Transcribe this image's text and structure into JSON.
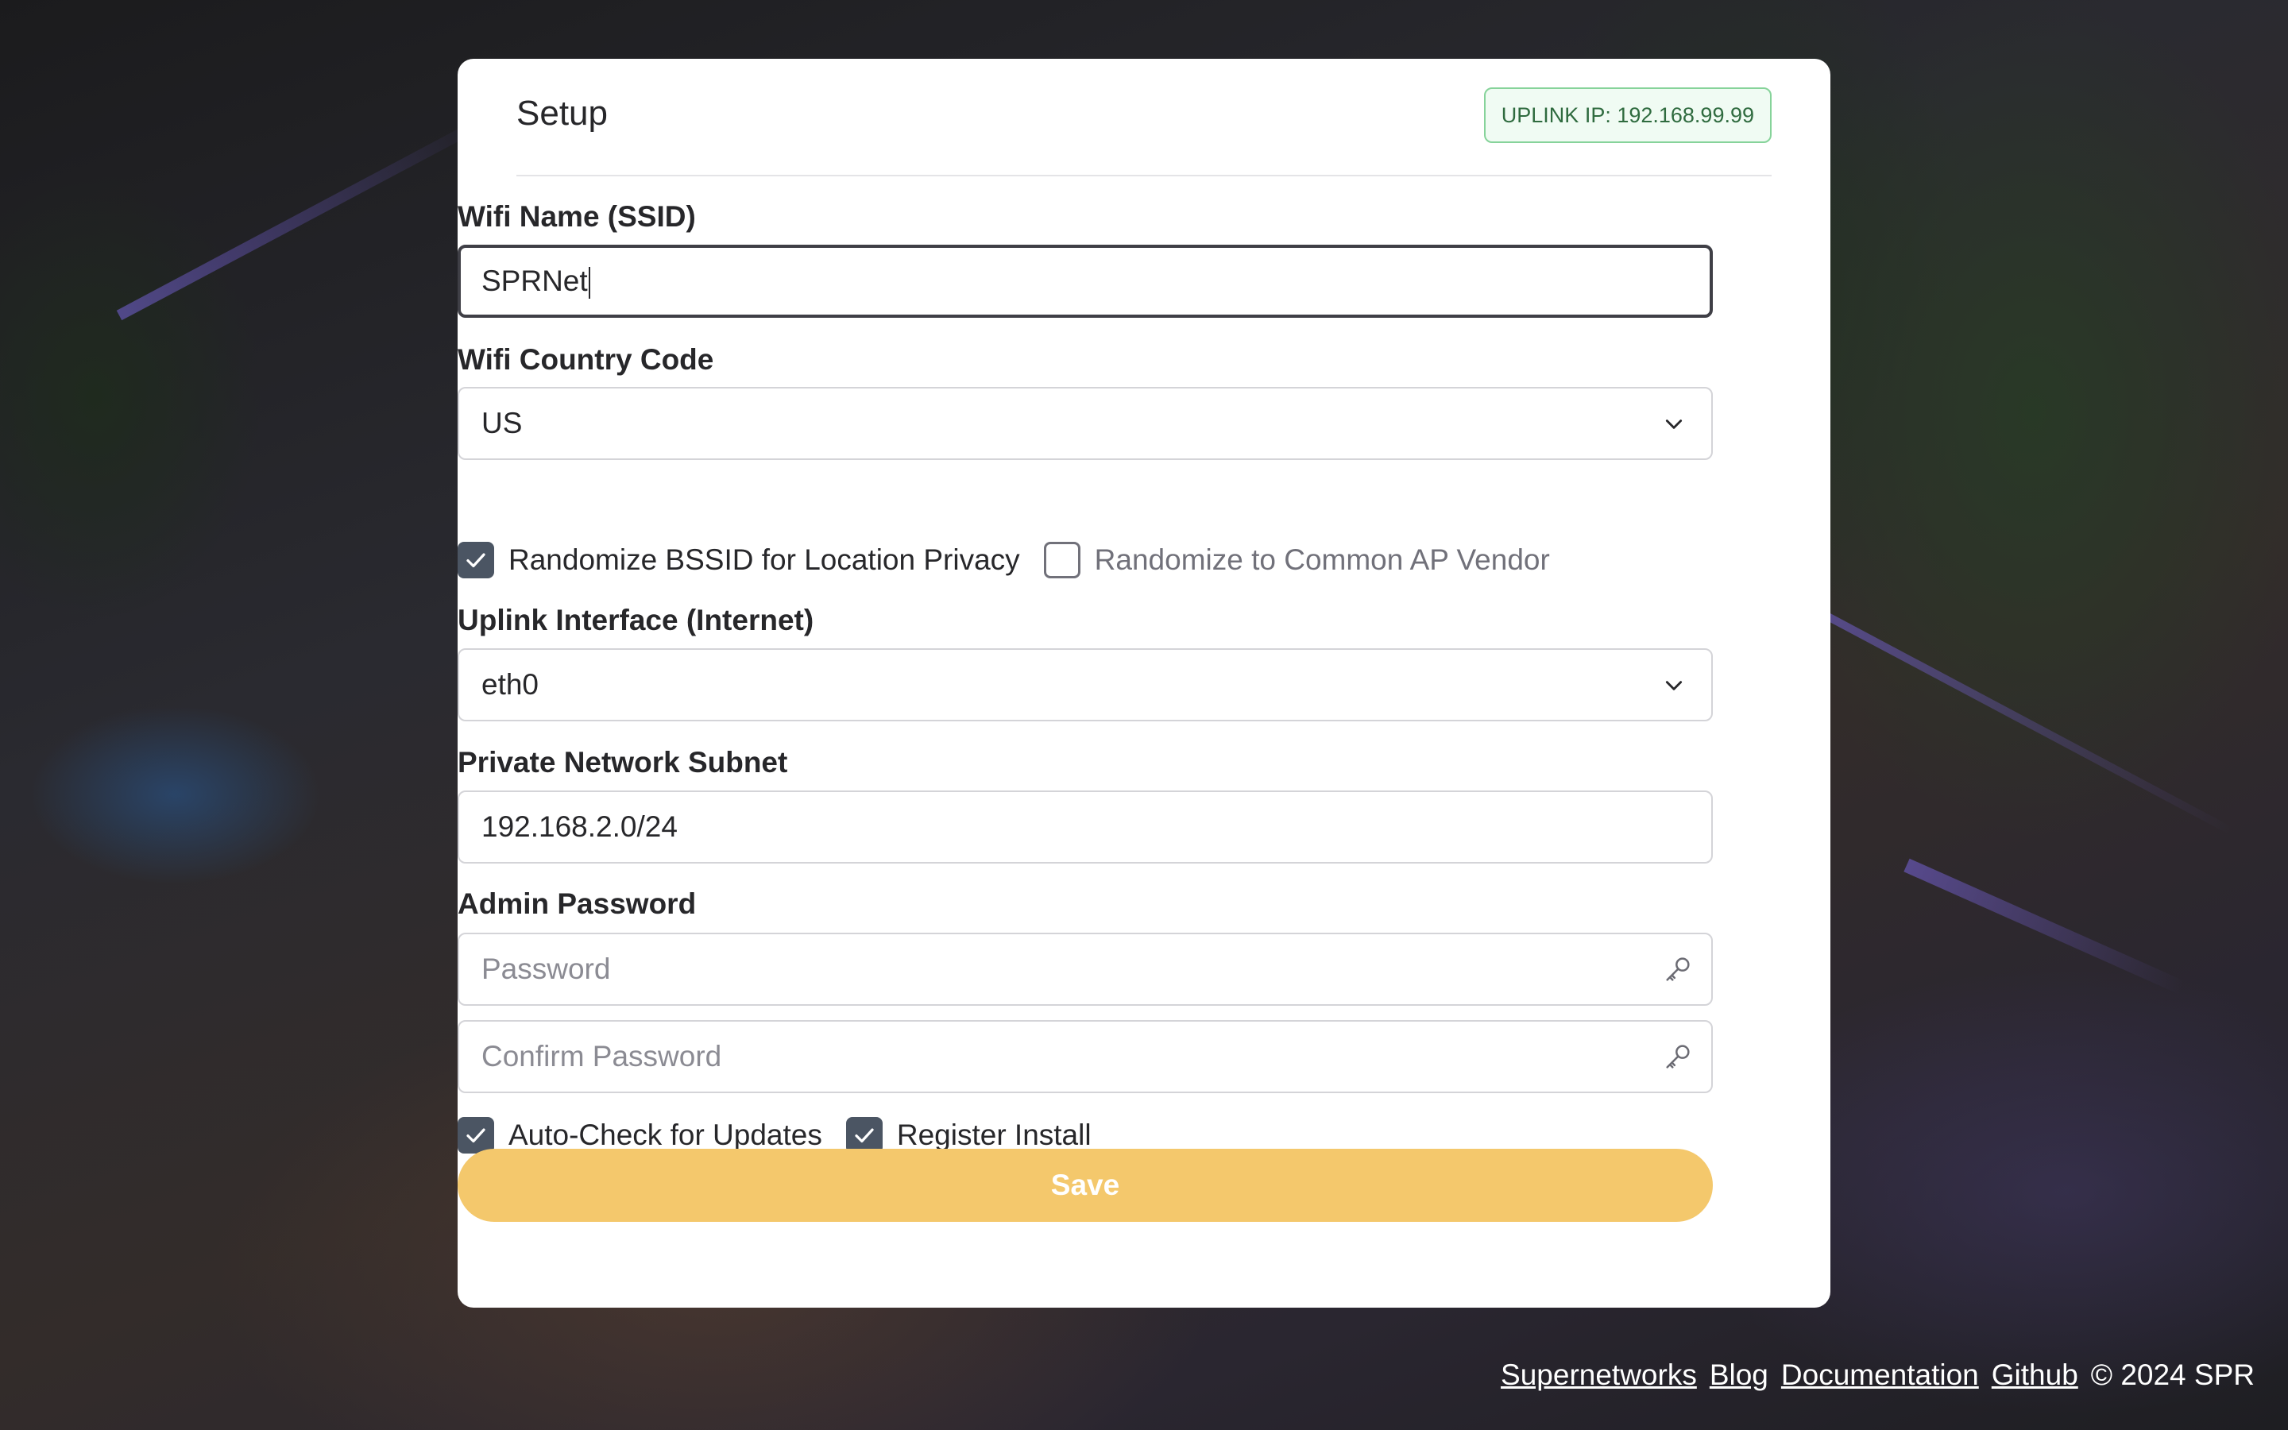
{
  "setup": {
    "title": "Setup",
    "uplink_ip": "UPLINK IP: 192.168.99.99"
  },
  "fields": {
    "ssid_label": "Wifi Name (SSID)",
    "ssid_value": "SPRNet",
    "country_label": "Wifi Country Code",
    "country_value": "US",
    "randomize_bssid_label": "Randomize BSSID for Location Privacy",
    "randomize_bssid_checked": true,
    "randomize_vendor_label": "Randomize to Common AP Vendor",
    "randomize_vendor_checked": false,
    "uplink_label": "Uplink Interface (Internet)",
    "uplink_value": "eth0",
    "subnet_label": "Private Network Subnet",
    "subnet_value": "192.168.2.0/24",
    "admin_password_label": "Admin Password",
    "password_placeholder": "Password",
    "confirm_password_placeholder": "Confirm Password",
    "auto_update_label": "Auto-Check for Updates",
    "auto_update_checked": true,
    "register_install_label": "Register Install",
    "register_install_checked": true
  },
  "actions": {
    "save_label": "Save"
  },
  "footer": {
    "links": [
      "Supernetworks",
      "Blog",
      "Documentation",
      "Github"
    ],
    "copyright": "© 2024 SPR"
  },
  "colors": {
    "save_button": "#f4c86c",
    "checkbox_checked": "#4b5563",
    "badge_border": "#86d39a",
    "badge_text": "#2f6b3f"
  }
}
